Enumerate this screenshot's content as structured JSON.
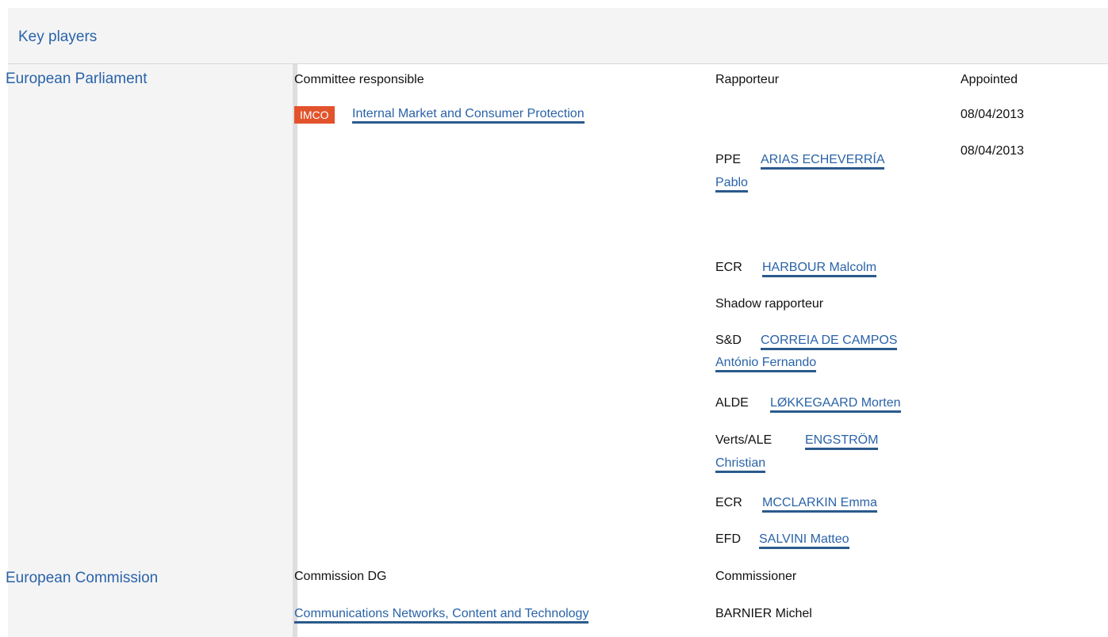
{
  "header": {
    "title": "Key players"
  },
  "parliament": {
    "title": "European Parliament",
    "col_committee": "Committee responsible",
    "col_rapporteur": "Rapporteur",
    "col_appointed": "Appointed",
    "committee": {
      "badge": "IMCO",
      "name": "Internal Market and Consumer Protection",
      "appointed": "08/04/2013"
    },
    "rapporteurs": [
      {
        "party": "PPE",
        "name_line1": "ARIAS ECHEVERRÍA",
        "name_line2": "Pablo",
        "appointed": "08/04/2013"
      },
      {
        "party": "ECR",
        "name_line1": "HARBOUR Malcolm"
      }
    ],
    "shadow_label": "Shadow rapporteur",
    "shadows": [
      {
        "party": "S&D",
        "name_line1": "CORREIA DE CAMPOS",
        "name_line2": "António Fernando"
      },
      {
        "party": "ALDE",
        "name_line1": "LØKKEGAARD Morten"
      },
      {
        "party": "Verts/ALE",
        "name_line1": "ENGSTRÖM",
        "name_line2": "Christian"
      },
      {
        "party": "ECR",
        "name_line1": "MCCLARKIN Emma"
      },
      {
        "party": "EFD",
        "name_line1": "SALVINI Matteo"
      }
    ]
  },
  "commission": {
    "title": "European Commission",
    "col_dg": "Commission DG",
    "col_commissioner": "Commissioner",
    "dg": "Communications Networks, Content and Technology",
    "commissioner": "BARNIER Michel"
  }
}
